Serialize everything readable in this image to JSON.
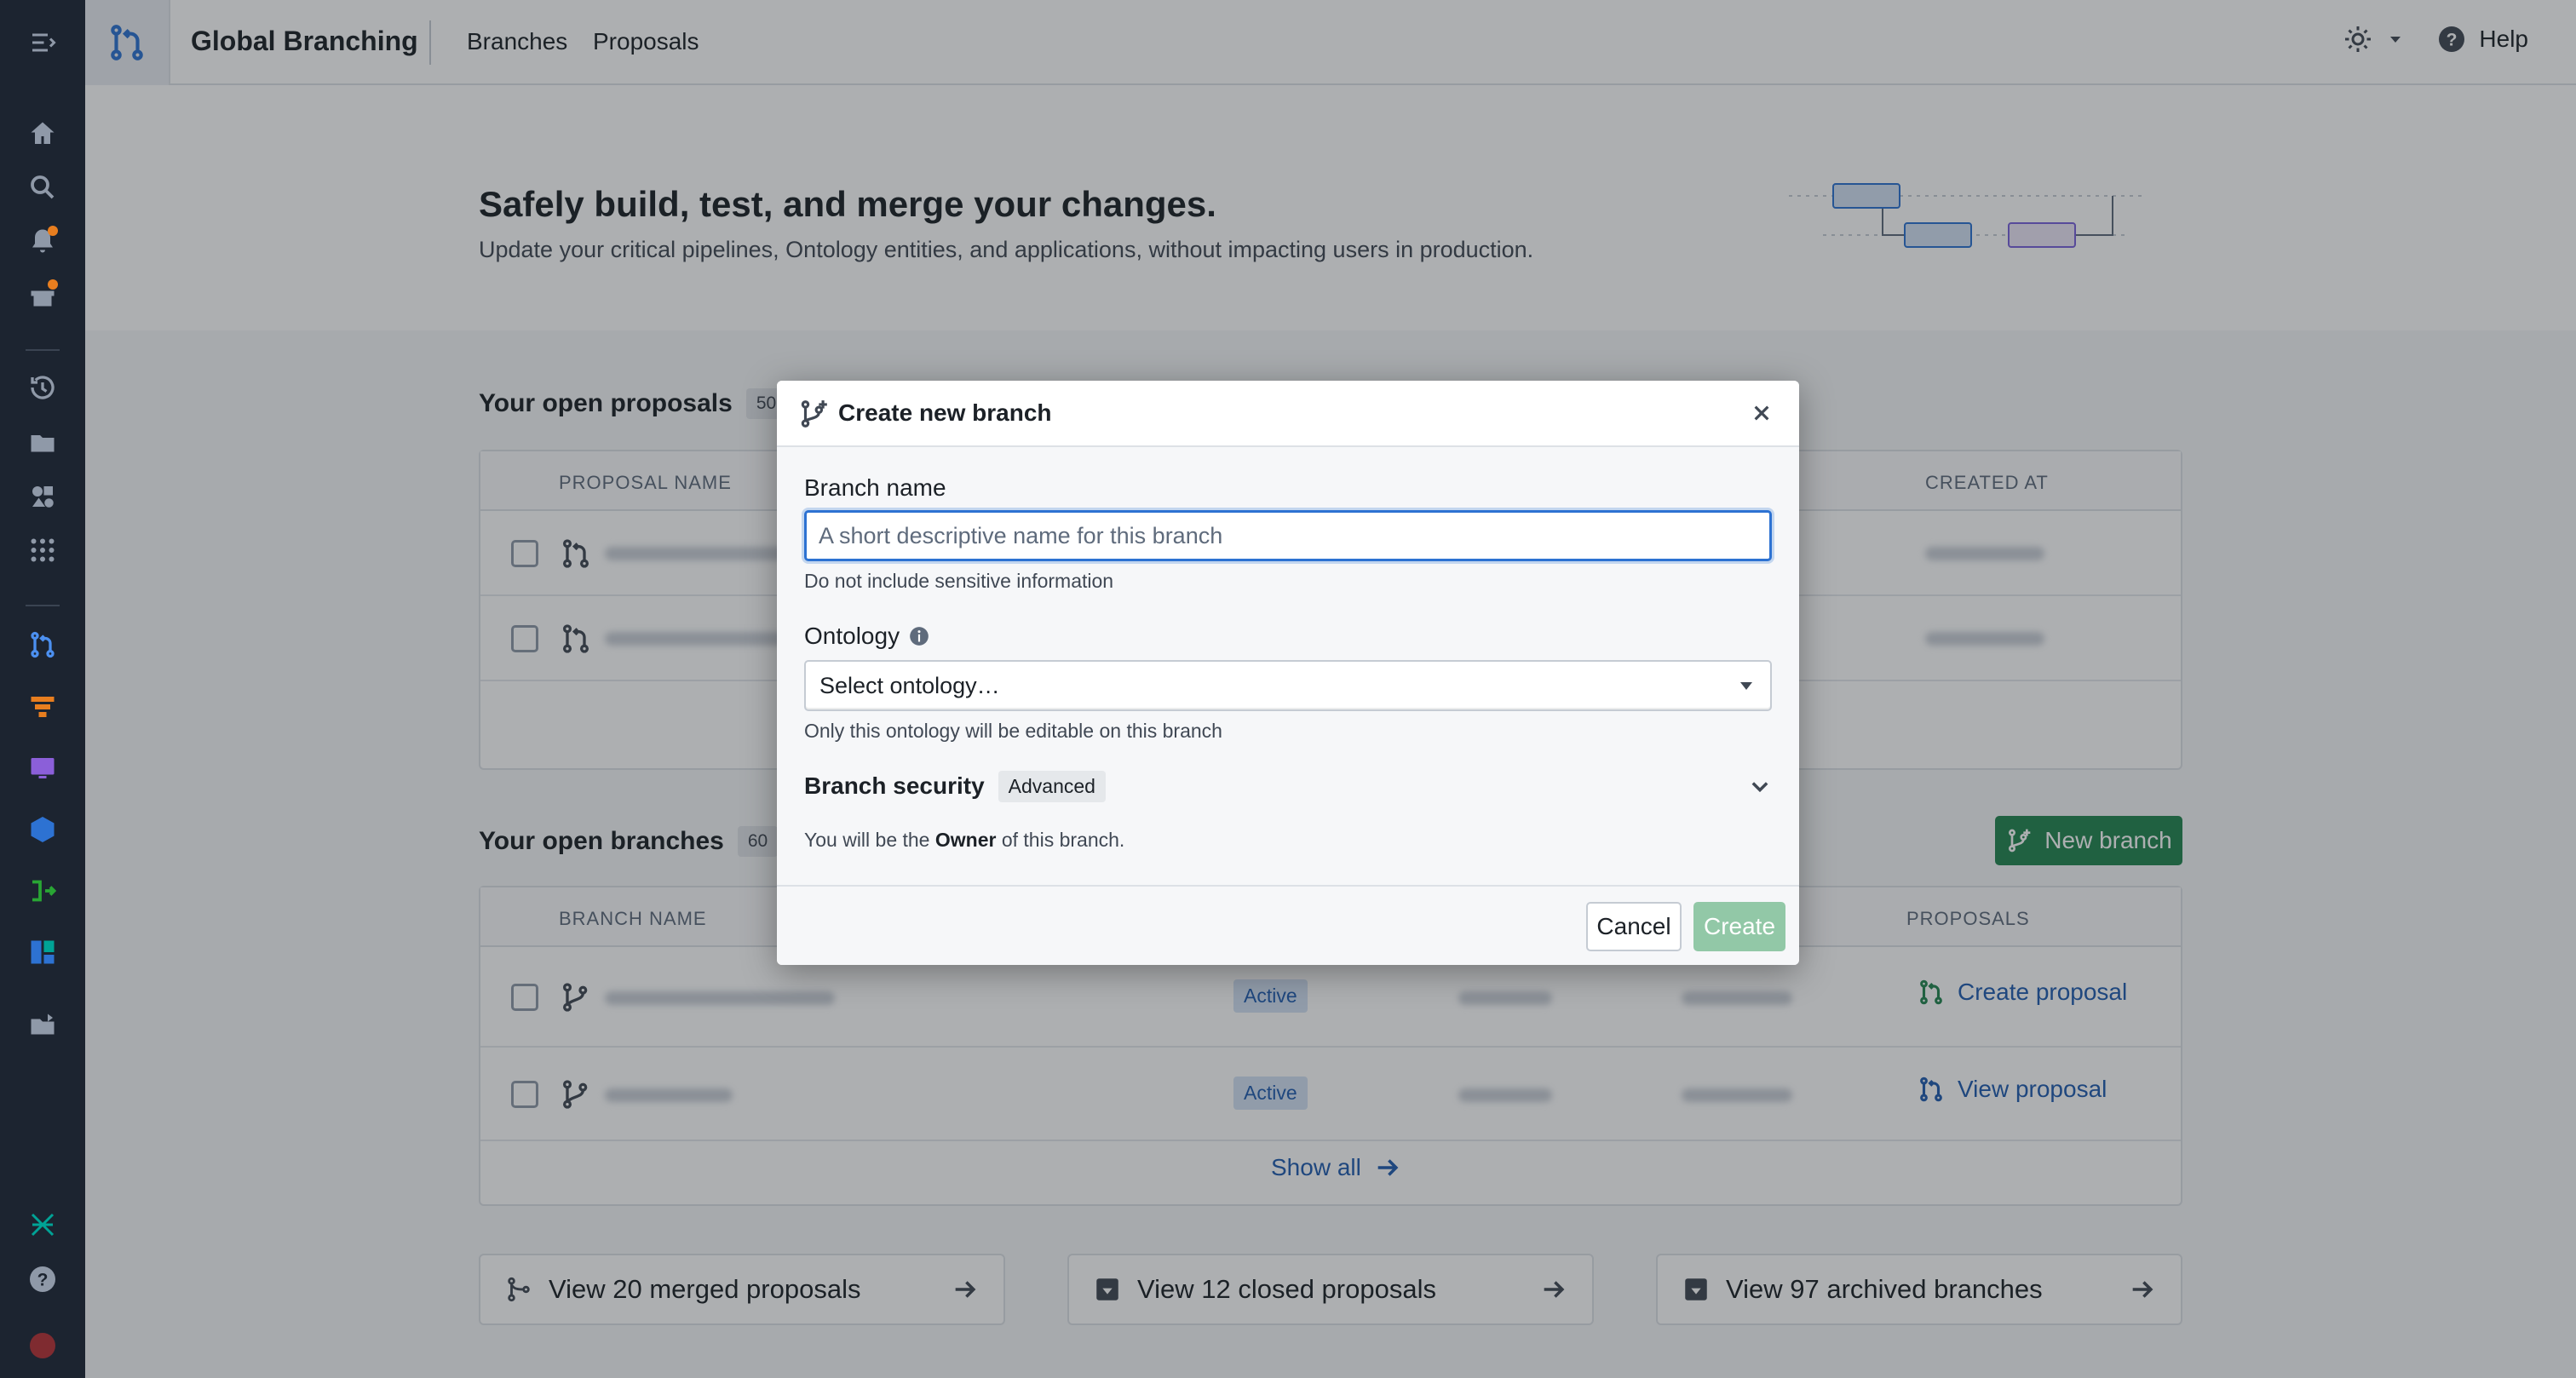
{
  "app": {
    "title": "Global Branching"
  },
  "nav": {
    "branches": "Branches",
    "proposals": "Proposals",
    "help": "Help"
  },
  "hero": {
    "title": "Safely build, test, and merge your changes.",
    "subtitle": "Update your critical pipelines, Ontology entities, and applications, without impacting users in production."
  },
  "proposals_section": {
    "title": "Your open proposals",
    "count": "50",
    "headers": {
      "name": "PROPOSAL NAME",
      "created_at": "CREATED AT"
    }
  },
  "branches_section": {
    "title": "Your open branches",
    "count": "60",
    "new_branch_label": "New branch",
    "headers": {
      "name": "BRANCH NAME",
      "proposals": "PROPOSALS"
    },
    "rows": [
      {
        "status": "Active",
        "action": "Create proposal"
      },
      {
        "status": "Active",
        "action": "View proposal"
      }
    ],
    "show_all": "Show all"
  },
  "footer_cards": [
    {
      "label": "View 20 merged proposals"
    },
    {
      "label": "View 12 closed proposals"
    },
    {
      "label": "View 97 archived branches"
    }
  ],
  "modal": {
    "title": "Create new branch",
    "branch_name_label": "Branch name",
    "branch_name_value": "",
    "branch_name_placeholder": "A short descriptive name for this branch",
    "branch_name_helper": "Do not include sensitive information",
    "ontology_label": "Ontology",
    "ontology_placeholder": "Select ontology…",
    "ontology_helper": "Only this ontology will be editable on this branch",
    "security_title": "Branch security",
    "security_tag": "Advanced",
    "owner_prefix": "You will be the",
    "owner_role": "Owner",
    "owner_suffix": "of this branch.",
    "cancel_label": "Cancel",
    "create_label": "Create"
  },
  "colors": {
    "accent": "#2d72d2",
    "primary_green": "#238551",
    "disabled_green": "#92c8a7",
    "rail": "#1c2430",
    "link": "#215db0"
  }
}
